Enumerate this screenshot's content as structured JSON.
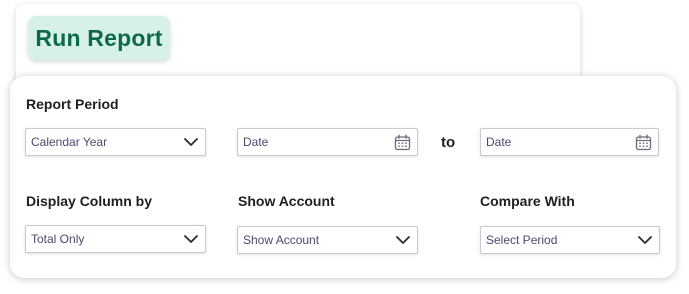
{
  "header": {
    "title": "Run Report"
  },
  "report_period": {
    "label": "Report Period",
    "period_select": {
      "value": "Calendar Year"
    },
    "from_date": {
      "placeholder": "Date"
    },
    "separator": "to",
    "to_date": {
      "placeholder": "Date"
    }
  },
  "display_column": {
    "label": "Display Column by",
    "value": "Total Only"
  },
  "show_account": {
    "label": "Show Account",
    "value": "Show Account"
  },
  "compare_with": {
    "label": "Compare With",
    "value": "Select Period"
  },
  "icons": {
    "dropdown": "chevron-down-icon",
    "date": "calendar-icon"
  },
  "colors": {
    "accent": "#0c6a4a",
    "badge_bg": "#d8f1e6",
    "field_text": "#4a4a6e"
  }
}
